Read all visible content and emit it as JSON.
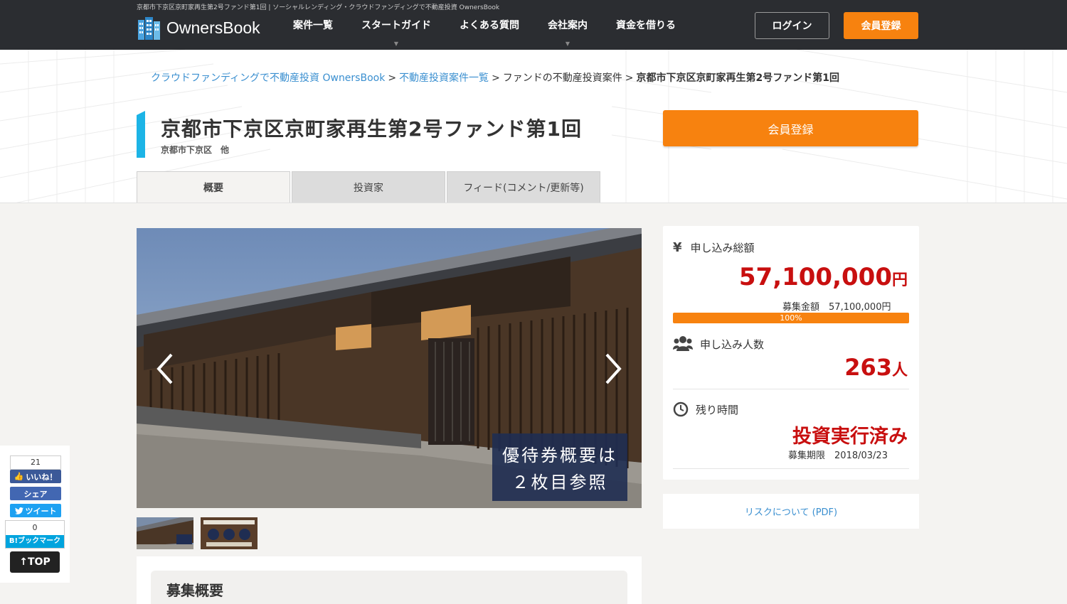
{
  "header": {
    "tagline": "京都市下京区京町家再生第2号ファンド第1回 | ソーシャルレンディング・クラウドファンディングで不動産投資 OwnersBook",
    "logo_text": "OwnersBook",
    "nav": [
      {
        "label": "案件一覧"
      },
      {
        "label": "スタートガイド"
      },
      {
        "label": "よくある質問"
      },
      {
        "label": "会社案内"
      },
      {
        "label": "資金を借りる"
      }
    ],
    "login_label": "ログイン",
    "register_label": "会員登録"
  },
  "breadcrumb": {
    "home": "クラウドファンディングで不動産投資 OwnersBook",
    "list": "不動産投資案件一覧",
    "category": "ファンドの不動産投資案件",
    "current": "京都市下京区京町家再生第2号ファンド第1回",
    "separator": ">"
  },
  "project": {
    "title": "京都市下京区京町家再生第2号ファンド第1回",
    "location": "京都市下京区　他",
    "register_label": "会員登録"
  },
  "tabs": [
    {
      "label": "概要"
    },
    {
      "label": "投資家"
    },
    {
      "label": "フィード(コメント/更新等)"
    }
  ],
  "gallery": {
    "caption_line1": "優待券概要は",
    "caption_line2": "２枚目参照"
  },
  "stats": {
    "total_label": "申し込み総額",
    "total_value": "57,100,000",
    "total_unit": "円",
    "target_label": "募集金額",
    "target_value": "57,100,000円",
    "progress_text": "100%",
    "progress_percent": 100,
    "people_label": "申し込み人数",
    "people_value": "263",
    "people_unit": "人",
    "time_label": "残り時間",
    "status": "投資実行済み",
    "deadline_label": "募集期限",
    "deadline_value": "2018/03/23"
  },
  "risk_link": "リスクについて (PDF)",
  "summary_heading": "募集概要",
  "social": {
    "fb_count": "21",
    "fb_like": "いいね！",
    "share": "シェア",
    "tweet": "ツイート",
    "hatena_count": "0",
    "hatena_label": "B!ブックマーク",
    "top_label": "↑TOP"
  },
  "colors": {
    "accent_orange": "#f7820f",
    "status_red": "#c80f0f",
    "link_blue": "#3a8fd0",
    "title_accent": "#1cb4e6"
  }
}
